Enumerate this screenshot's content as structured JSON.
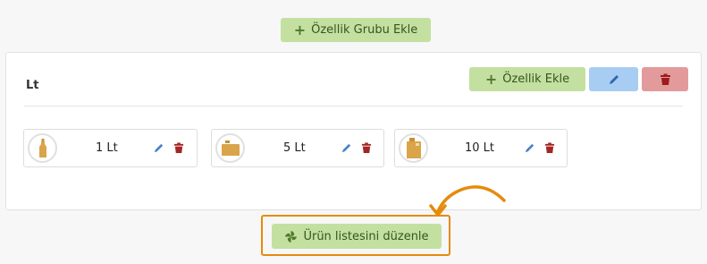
{
  "toolbar": {
    "add_group_label": "Özellik Grubu Ekle"
  },
  "group": {
    "title": "Lt",
    "add_feature_label": "Özellik Ekle",
    "items": [
      {
        "label": "1 Lt",
        "icon": "bottle-icon"
      },
      {
        "label": "5 Lt",
        "icon": "canister-icon"
      },
      {
        "label": "10 Lt",
        "icon": "jerrycan-icon"
      }
    ]
  },
  "footer": {
    "edit_list_label": "Ürün listesini düzenle"
  },
  "colors": {
    "green_button": "#c3e0a1",
    "blue_button": "#a8cdf3",
    "red_button": "#e29a9b",
    "highlight": "#e58b0c",
    "icon_product": "#d9a44a"
  }
}
